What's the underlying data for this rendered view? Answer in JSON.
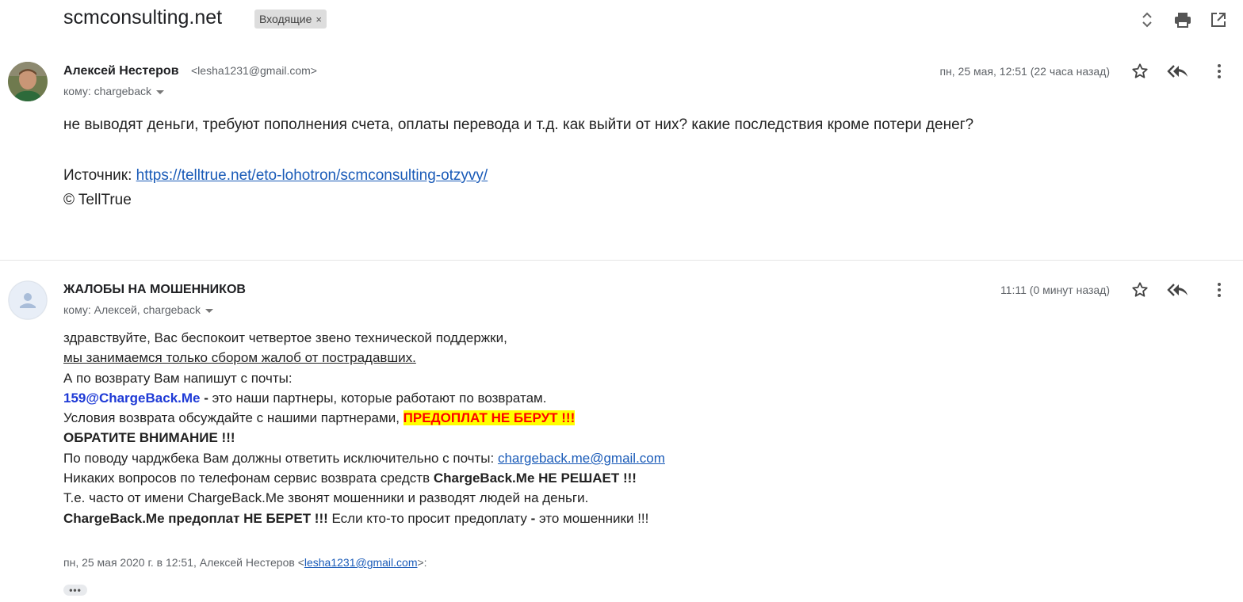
{
  "thread": {
    "subject": "scmconsulting.net",
    "label": "Входящие",
    "label_close": "×"
  },
  "toolbar_icons": [
    "expand-collapse-icon",
    "print-icon",
    "open-in-new-window-icon"
  ],
  "messages": [
    {
      "sender_name": "Алексей Нестеров",
      "sender_email": "<lesha1231@gmail.com>",
      "to": "кому: chargeback",
      "date": "пн, 25 мая, 12:51 (22 часа назад)",
      "body": "не выводят деньги, требуют пополнения счета, оплаты перевода и т.д. как выйти от них? какие последствия кроме потери денег?",
      "source_label": "Источник:",
      "source_link": "https://telltrue.net/eto-lohotron/scmconsulting-otzyvy/",
      "copyright": "© TellTrue"
    },
    {
      "sender_name": "ЖАЛОБЫ НА МОШЕННИКОВ",
      "to": "кому: Алексей, chargeback",
      "date": "11:11 (0 минут назад)",
      "lines": {
        "l1": "здравствуйте, Вас беспокоит четвертое звено технической поддержки,",
        "l2": "мы занимаемся только сбором жалоб от пострадавших.",
        "l3": "А по возврату Вам напишут с почты:",
        "l4_email": "159@ChargeBack.Me",
        "l4_dash": " - ",
        "l4_rest": "это наши партнеры, которые работают по возвратам.",
        "l5_text": "Условия возврата обсуждайте с нашими партнерами, ",
        "l5_highlight": "ПРЕДОПЛАТ НЕ БЕРУТ !!!",
        "l6": "ОБРАТИТЕ ВНИМАНИЕ !!!",
        "l7_text": "По поводу чарджбека Вам должны ответить исключительно с почты: ",
        "l7_link": "chargeback.me@gmail.com",
        "l8_text": "Никаких вопросов по телефонам сервис возврата средств ",
        "l8_bold": "ChargeBack.Me НЕ РЕШАЕТ !!!",
        "l9": "Т.е. часто от имени ChargeBack.Me звонят мошенники и разводят людей на деньги.",
        "l10_bold": "ChargeBack.Me предоплат НЕ БЕРЕТ !!!",
        "l10_text": " Если кто-то просит предоплату ",
        "l10_dash": "-",
        "l10_rest": " это мошенники !!!"
      },
      "quote_prefix": "пн, 25 мая 2020 г. в 12:51, Алексей Нестеров <",
      "quote_email": "lesha1231@gmail.com",
      "quote_suffix": ">:",
      "ellipsis": "•••"
    }
  ],
  "colors": {
    "link": "#1a5bb8",
    "highlight_bg": "#ffff00",
    "highlight_text": "#ff0000",
    "email_blue": "#1e3ad6"
  }
}
